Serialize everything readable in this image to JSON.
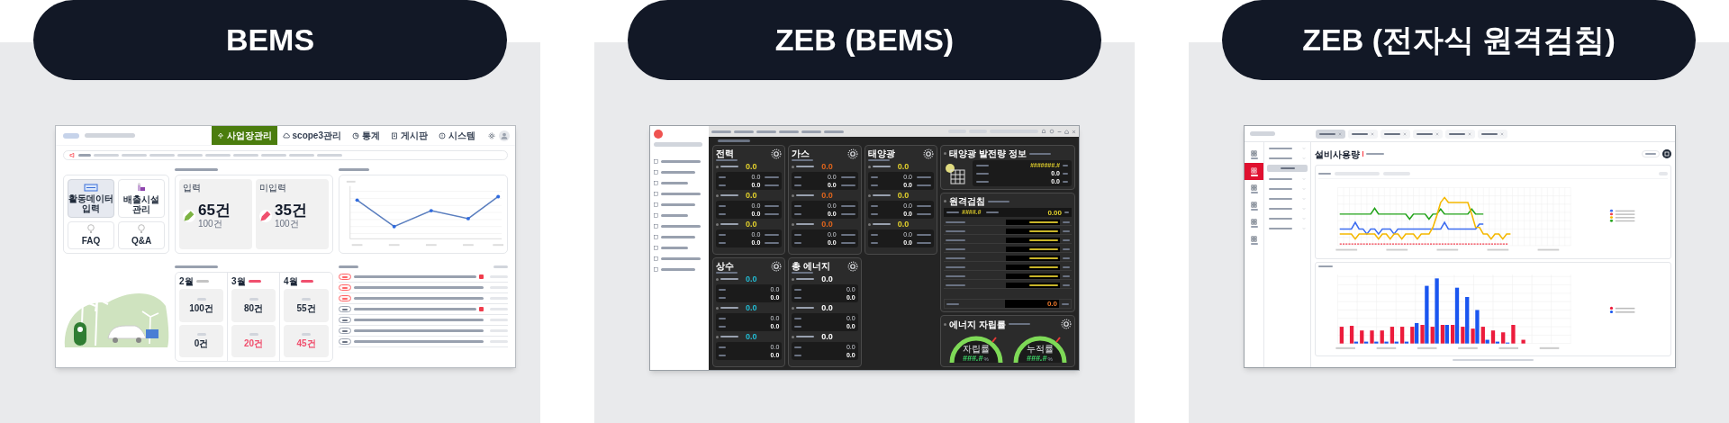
{
  "panels": [
    {
      "kind": "bems",
      "title": "BEMS",
      "screen": {
        "nav": [
          {
            "label": "사업장관리",
            "selected": true
          },
          {
            "label": "scope3관리",
            "selected": false
          },
          {
            "label": "통계",
            "selected": false
          },
          {
            "label": "게시판",
            "selected": false
          },
          {
            "label": "시스템",
            "selected": false
          }
        ],
        "tiles": [
          {
            "label": "활동데이터 입력",
            "selected": true
          },
          {
            "label": "배출시설 관리",
            "selected": false
          },
          {
            "label": "FAQ",
            "selected": false
          },
          {
            "label": "Q&A",
            "selected": false
          }
        ],
        "summary": [
          {
            "label": "입력",
            "value": "65건",
            "total": "100건",
            "color": "#7cb342"
          },
          {
            "label": "미입력",
            "value": "35건",
            "total": "100건",
            "color": "#f0506e"
          }
        ],
        "months": [
          {
            "month": "2월",
            "color": "#c4c4c4",
            "entries": [
              {
                "value": "100건",
                "alert": false
              },
              {
                "value": "0건",
                "alert": false
              }
            ]
          },
          {
            "month": "3월",
            "color": "#f0506e",
            "entries": [
              {
                "value": "80건",
                "alert": false
              },
              {
                "value": "20건",
                "alert": true
              }
            ]
          },
          {
            "month": "4월",
            "color": "#f0506e",
            "entries": [
              {
                "value": "55건",
                "alert": false
              },
              {
                "value": "45건",
                "alert": true
              }
            ]
          }
        ],
        "notices": [
          {
            "kind": "urgent",
            "new": true
          },
          {
            "kind": "urgent",
            "new": false
          },
          {
            "kind": "urgent",
            "new": false
          },
          {
            "kind": "normal",
            "new": true
          },
          {
            "kind": "normal",
            "new": false
          },
          {
            "kind": "normal",
            "new": false
          },
          {
            "kind": "normal",
            "new": false
          }
        ]
      }
    },
    {
      "kind": "zeb_bems",
      "title": "ZEB (BEMS)",
      "screen": {
        "cards": [
          {
            "title": "전력",
            "color": "#e3d12c",
            "percent": true,
            "groups": [
              {
                "value": "0.0",
                "rows": [
                  "0.0",
                  "0.0"
                ]
              },
              {
                "value": "0.0",
                "rows": [
                  "0.0",
                  "0.0"
                ]
              },
              {
                "value": "0.0",
                "rows": [
                  "0.0",
                  "0.0"
                ]
              }
            ]
          },
          {
            "title": "가스",
            "color": "#e0651c",
            "percent": true,
            "groups": [
              {
                "value": "0.0",
                "rows": [
                  "0.0",
                  "0.0"
                ]
              },
              {
                "value": "0.0",
                "rows": [
                  "0.0",
                  "0.0"
                ]
              },
              {
                "value": "0.0",
                "rows": [
                  "0.0",
                  "0.0"
                ]
              }
            ]
          },
          {
            "title": "태양광",
            "color": "#e3d12c",
            "percent": true,
            "groups": [
              {
                "value": "0.0",
                "rows": [
                  "0.0",
                  "0.0"
                ]
              },
              {
                "value": "0.0",
                "rows": [
                  "0.0",
                  "0.0"
                ]
              },
              {
                "value": "0.0",
                "rows": [
                  "0.0",
                  "0.0"
                ]
              }
            ]
          },
          {
            "title": "상수",
            "color": "#22bcd4",
            "percent": false,
            "groups": [
              {
                "value": "0.0",
                "rows": [
                  "0.0",
                  "0.0"
                ]
              },
              {
                "value": "0.0",
                "rows": [
                  "0.0",
                  "0.0"
                ]
              },
              {
                "value": "0.0",
                "rows": [
                  "0.0",
                  "0.0"
                ]
              }
            ]
          },
          {
            "title": "총 에너지",
            "color": "#ffffff",
            "percent": false,
            "groups": [
              {
                "value": "0.0",
                "rows": [
                  "0.0",
                  "0.0"
                ]
              },
              {
                "value": "0.0",
                "rows": [
                  "0.0",
                  "0.0"
                ]
              },
              {
                "value": "0.0",
                "rows": [
                  "0.0",
                  "0.0"
                ]
              }
            ]
          }
        ],
        "solar": {
          "title": "태양광 발전량 정보",
          "values": [
            "#######.#",
            "0.0",
            "0.0"
          ]
        },
        "meter": {
          "title": "원격검침",
          "now": "####.#",
          "total": "0.00",
          "ghp": "0.0"
        },
        "independence": {
          "title": "에너지 자립률",
          "gauges": [
            {
              "label": "자립률",
              "value": "###.#",
              "unit": "%"
            },
            {
              "label": "누적률",
              "value": "###.#",
              "unit": "%"
            }
          ]
        }
      }
    },
    {
      "kind": "zeb_meter",
      "title": "ZEB (전자식 원격검침)",
      "screen": {
        "tabs": [
          {
            "selected": true
          },
          {
            "selected": false
          },
          {
            "selected": false
          },
          {
            "selected": false
          },
          {
            "selected": false
          },
          {
            "selected": false
          }
        ],
        "rail": [
          {
            "selected": false
          },
          {
            "selected": true
          },
          {
            "selected": false
          },
          {
            "selected": false
          },
          {
            "selected": false
          },
          {
            "selected": false
          }
        ],
        "title": "설비사용량"
      }
    }
  ]
}
